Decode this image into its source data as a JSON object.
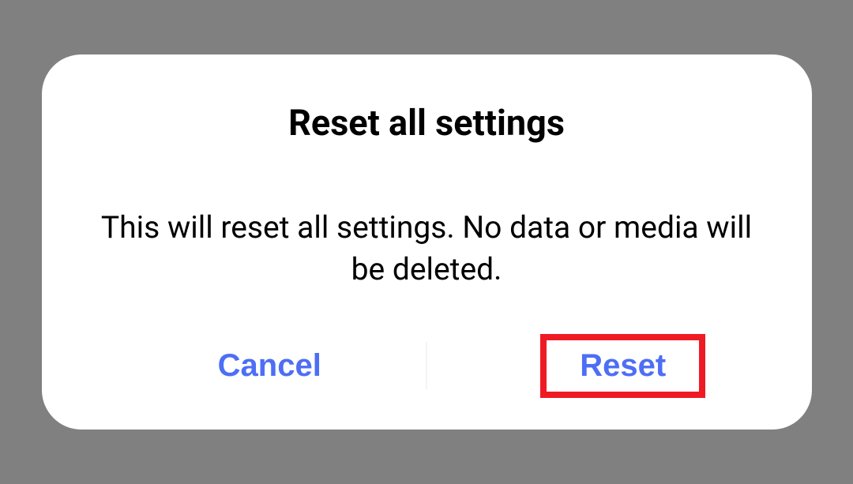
{
  "dialog": {
    "title": "Reset all settings",
    "message": "This will reset all settings. No data or media will be deleted.",
    "cancel_label": "Cancel",
    "confirm_label": "Reset"
  }
}
